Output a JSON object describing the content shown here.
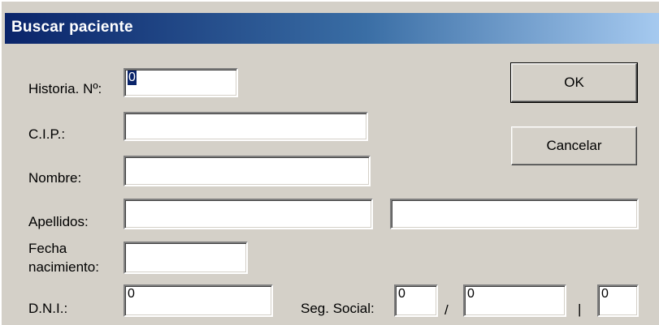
{
  "window": {
    "title": "Buscar paciente"
  },
  "buttons": {
    "ok": "OK",
    "cancel": "Cancelar"
  },
  "form": {
    "historia": {
      "label": "Historia. Nº:",
      "value": "0"
    },
    "cip": {
      "label": "C.I.P.:",
      "value": ""
    },
    "nombre": {
      "label": "Nombre:",
      "value": ""
    },
    "apellidos": {
      "label": "Apellidos:",
      "value1": "",
      "value2": ""
    },
    "fecha": {
      "label_line1": "Fecha",
      "label_line2": "nacimiento:",
      "value": ""
    },
    "dni": {
      "label": "D.N.I.:",
      "value": "0"
    },
    "seg_social": {
      "label": "Seg. Social:",
      "value1": "0",
      "sep1": "/",
      "value2": "0",
      "sep2": "|",
      "value3": "0"
    }
  },
  "colors": {
    "titlebar_start": "#0a246a",
    "titlebar_end": "#a6caf0",
    "dialog_bg": "#d4d0c8",
    "selection": "#0a246a"
  }
}
